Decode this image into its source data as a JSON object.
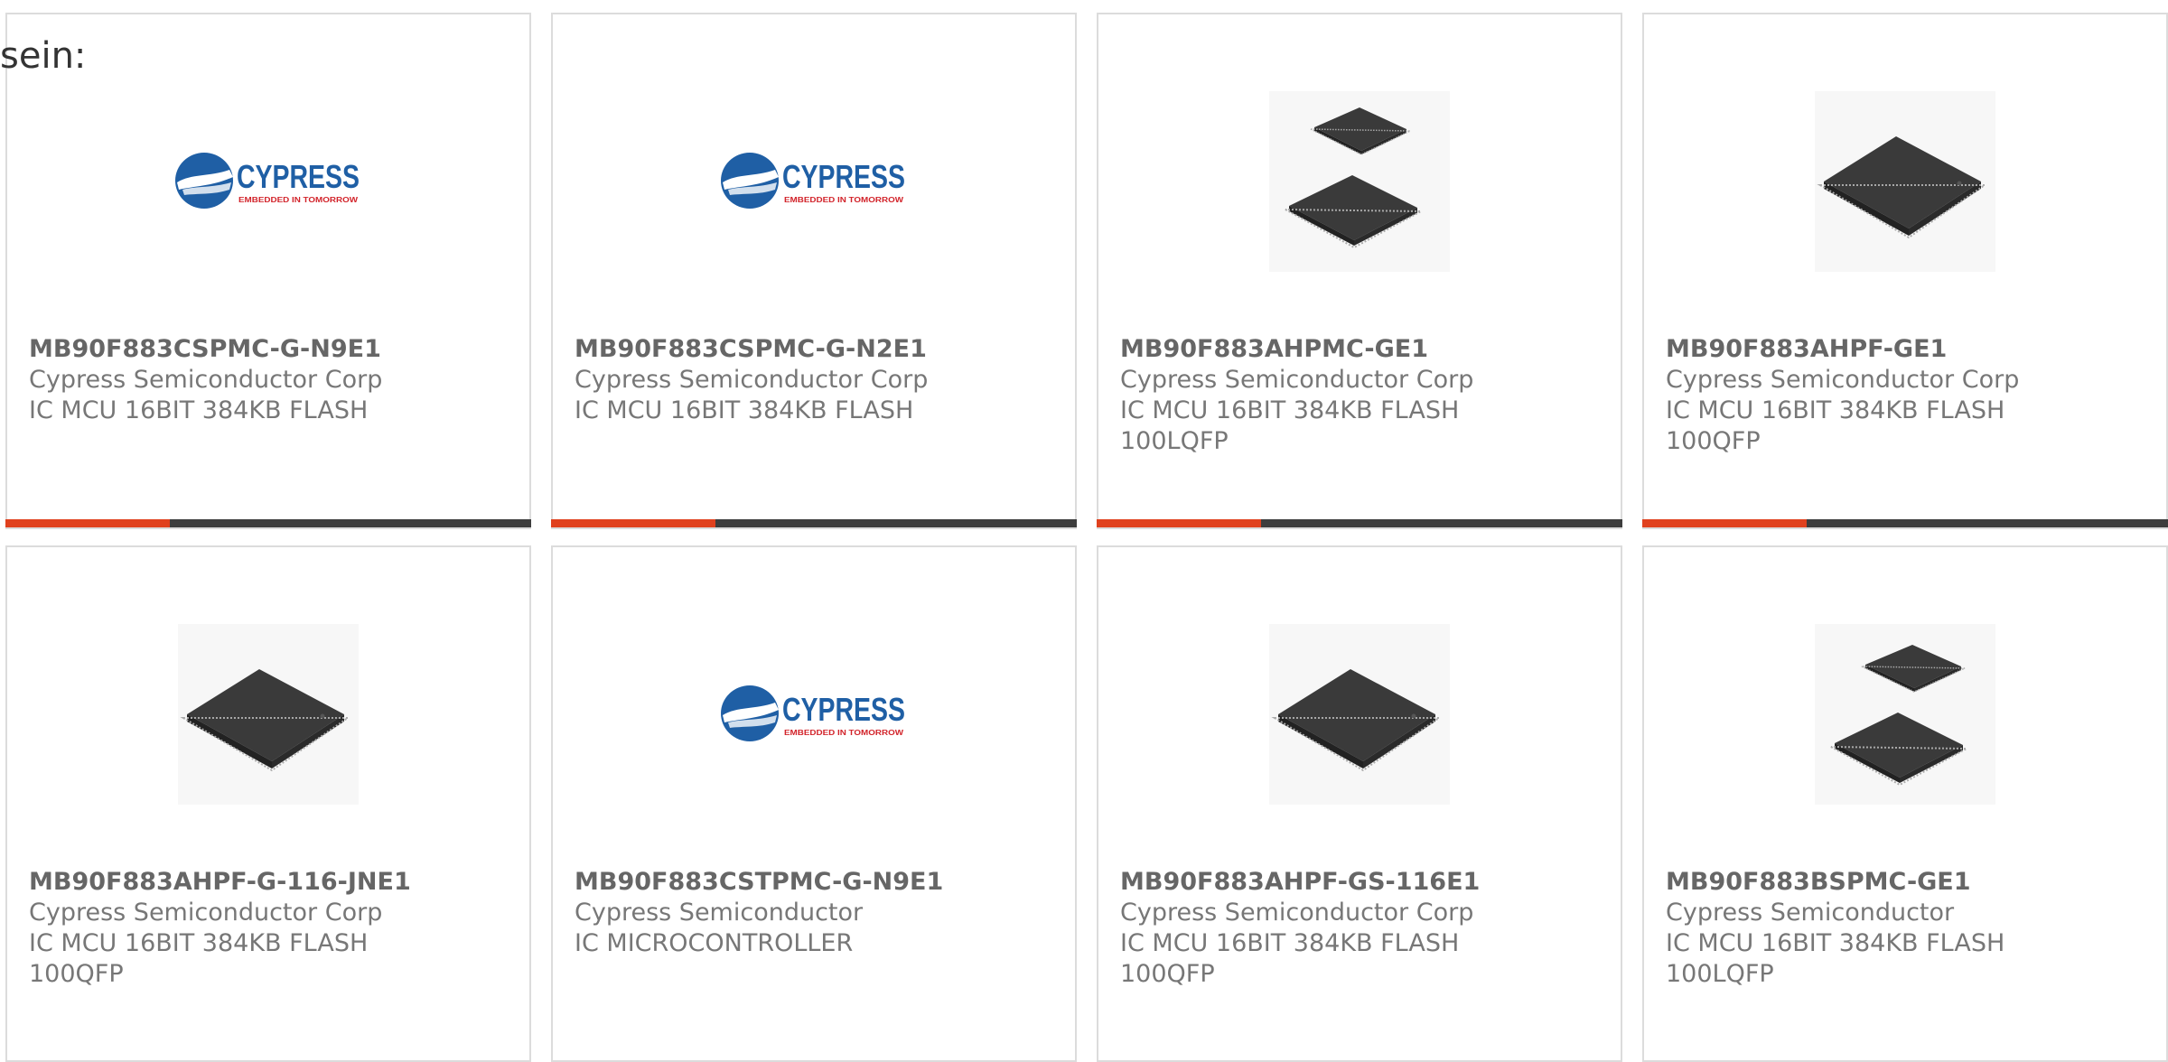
{
  "lead_text": "sein:",
  "colors": {
    "accent": "#e0411e",
    "bar_dark": "#3d3d3d",
    "cypress_blue": "#1f5fa5",
    "cypress_red": "#d2232a"
  },
  "logo": {
    "brand": "CYPRESS",
    "tagline": "EMBEDDED IN TOMORROW"
  },
  "products": [
    {
      "part": "MB90F883CSPMC-G-N9E1",
      "maker": "Cypress Semiconductor Corp",
      "desc1": "IC MCU 16BIT 384KB FLASH",
      "desc2": "",
      "image": "cypress-logo"
    },
    {
      "part": "MB90F883CSPMC-G-N2E1",
      "maker": "Cypress Semiconductor Corp",
      "desc1": "IC MCU 16BIT 384KB FLASH",
      "desc2": "",
      "image": "cypress-logo"
    },
    {
      "part": "MB90F883AHPMC-GE1",
      "maker": "Cypress Semiconductor Corp",
      "desc1": "IC MCU 16BIT 384KB FLASH",
      "desc2": "100LQFP",
      "image": "chip-pair"
    },
    {
      "part": "MB90F883AHPF-GE1",
      "maker": "Cypress Semiconductor Corp",
      "desc1": "IC MCU 16BIT 384KB FLASH",
      "desc2": "100QFP",
      "image": "chip-single"
    },
    {
      "part": "MB90F883AHPF-G-116-JNE1",
      "maker": "Cypress Semiconductor Corp",
      "desc1": "IC MCU 16BIT 384KB FLASH",
      "desc2": "100QFP",
      "image": "chip-single"
    },
    {
      "part": "MB90F883CSTPMC-G-N9E1",
      "maker": "Cypress Semiconductor",
      "desc1": "IC MICROCONTROLLER",
      "desc2": "",
      "image": "cypress-logo"
    },
    {
      "part": "MB90F883AHPF-GS-116E1",
      "maker": "Cypress Semiconductor Corp",
      "desc1": "IC MCU 16BIT 384KB FLASH",
      "desc2": "100QFP",
      "image": "chip-single"
    },
    {
      "part": "MB90F883BSPMC-GE1",
      "maker": "Cypress Semiconductor",
      "desc1": "IC MCU 16BIT 384KB FLASH",
      "desc2": "100LQFP",
      "image": "chip-pair"
    }
  ]
}
